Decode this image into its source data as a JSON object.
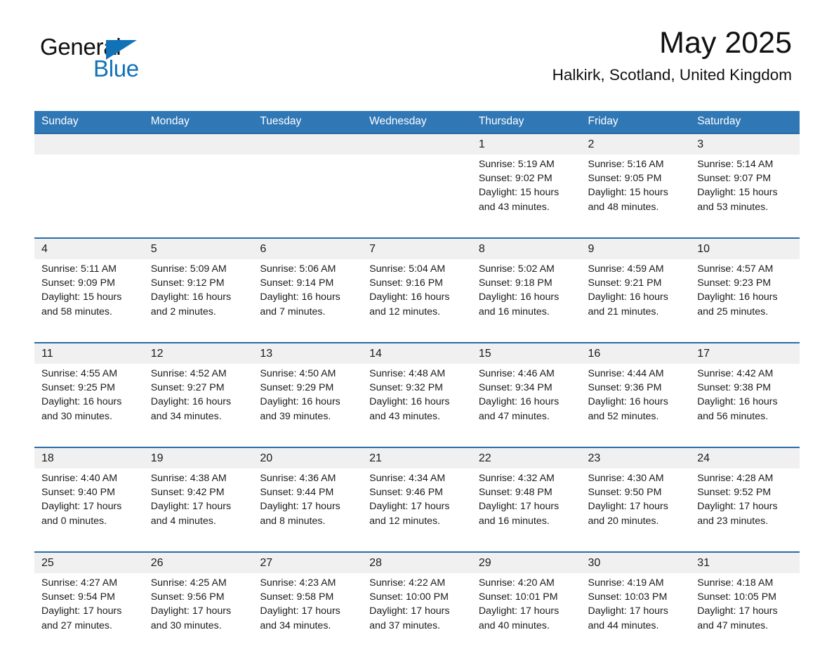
{
  "logo": {
    "word_one": "General",
    "word_two": "Blue",
    "triangle_icon": "triangle-icon",
    "brand_blue": "#1272b8"
  },
  "header": {
    "month_title": "May 2025",
    "location": "Halkirk, Scotland, United Kingdom",
    "header_blue": "#3077b6",
    "row_rule_blue": "#2b6ca8",
    "daynum_band": "#f0f0f0"
  },
  "weekday_headers": [
    "Sunday",
    "Monday",
    "Tuesday",
    "Wednesday",
    "Thursday",
    "Friday",
    "Saturday"
  ],
  "weeks": [
    {
      "days": [
        {
          "num": "",
          "sunrise": "",
          "sunset": "",
          "daylight_1": "",
          "daylight_2": "",
          "empty": true
        },
        {
          "num": "",
          "sunrise": "",
          "sunset": "",
          "daylight_1": "",
          "daylight_2": "",
          "empty": true
        },
        {
          "num": "",
          "sunrise": "",
          "sunset": "",
          "daylight_1": "",
          "daylight_2": "",
          "empty": true
        },
        {
          "num": "",
          "sunrise": "",
          "sunset": "",
          "daylight_1": "",
          "daylight_2": "",
          "empty": true
        },
        {
          "num": "1",
          "sunrise": "Sunrise: 5:19 AM",
          "sunset": "Sunset: 9:02 PM",
          "daylight_1": "Daylight: 15 hours",
          "daylight_2": "and 43 minutes.",
          "empty": false
        },
        {
          "num": "2",
          "sunrise": "Sunrise: 5:16 AM",
          "sunset": "Sunset: 9:05 PM",
          "daylight_1": "Daylight: 15 hours",
          "daylight_2": "and 48 minutes.",
          "empty": false
        },
        {
          "num": "3",
          "sunrise": "Sunrise: 5:14 AM",
          "sunset": "Sunset: 9:07 PM",
          "daylight_1": "Daylight: 15 hours",
          "daylight_2": "and 53 minutes.",
          "empty": false
        }
      ]
    },
    {
      "days": [
        {
          "num": "4",
          "sunrise": "Sunrise: 5:11 AM",
          "sunset": "Sunset: 9:09 PM",
          "daylight_1": "Daylight: 15 hours",
          "daylight_2": "and 58 minutes.",
          "empty": false
        },
        {
          "num": "5",
          "sunrise": "Sunrise: 5:09 AM",
          "sunset": "Sunset: 9:12 PM",
          "daylight_1": "Daylight: 16 hours",
          "daylight_2": "and 2 minutes.",
          "empty": false
        },
        {
          "num": "6",
          "sunrise": "Sunrise: 5:06 AM",
          "sunset": "Sunset: 9:14 PM",
          "daylight_1": "Daylight: 16 hours",
          "daylight_2": "and 7 minutes.",
          "empty": false
        },
        {
          "num": "7",
          "sunrise": "Sunrise: 5:04 AM",
          "sunset": "Sunset: 9:16 PM",
          "daylight_1": "Daylight: 16 hours",
          "daylight_2": "and 12 minutes.",
          "empty": false
        },
        {
          "num": "8",
          "sunrise": "Sunrise: 5:02 AM",
          "sunset": "Sunset: 9:18 PM",
          "daylight_1": "Daylight: 16 hours",
          "daylight_2": "and 16 minutes.",
          "empty": false
        },
        {
          "num": "9",
          "sunrise": "Sunrise: 4:59 AM",
          "sunset": "Sunset: 9:21 PM",
          "daylight_1": "Daylight: 16 hours",
          "daylight_2": "and 21 minutes.",
          "empty": false
        },
        {
          "num": "10",
          "sunrise": "Sunrise: 4:57 AM",
          "sunset": "Sunset: 9:23 PM",
          "daylight_1": "Daylight: 16 hours",
          "daylight_2": "and 25 minutes.",
          "empty": false
        }
      ]
    },
    {
      "days": [
        {
          "num": "11",
          "sunrise": "Sunrise: 4:55 AM",
          "sunset": "Sunset: 9:25 PM",
          "daylight_1": "Daylight: 16 hours",
          "daylight_2": "and 30 minutes.",
          "empty": false
        },
        {
          "num": "12",
          "sunrise": "Sunrise: 4:52 AM",
          "sunset": "Sunset: 9:27 PM",
          "daylight_1": "Daylight: 16 hours",
          "daylight_2": "and 34 minutes.",
          "empty": false
        },
        {
          "num": "13",
          "sunrise": "Sunrise: 4:50 AM",
          "sunset": "Sunset: 9:29 PM",
          "daylight_1": "Daylight: 16 hours",
          "daylight_2": "and 39 minutes.",
          "empty": false
        },
        {
          "num": "14",
          "sunrise": "Sunrise: 4:48 AM",
          "sunset": "Sunset: 9:32 PM",
          "daylight_1": "Daylight: 16 hours",
          "daylight_2": "and 43 minutes.",
          "empty": false
        },
        {
          "num": "15",
          "sunrise": "Sunrise: 4:46 AM",
          "sunset": "Sunset: 9:34 PM",
          "daylight_1": "Daylight: 16 hours",
          "daylight_2": "and 47 minutes.",
          "empty": false
        },
        {
          "num": "16",
          "sunrise": "Sunrise: 4:44 AM",
          "sunset": "Sunset: 9:36 PM",
          "daylight_1": "Daylight: 16 hours",
          "daylight_2": "and 52 minutes.",
          "empty": false
        },
        {
          "num": "17",
          "sunrise": "Sunrise: 4:42 AM",
          "sunset": "Sunset: 9:38 PM",
          "daylight_1": "Daylight: 16 hours",
          "daylight_2": "and 56 minutes.",
          "empty": false
        }
      ]
    },
    {
      "days": [
        {
          "num": "18",
          "sunrise": "Sunrise: 4:40 AM",
          "sunset": "Sunset: 9:40 PM",
          "daylight_1": "Daylight: 17 hours",
          "daylight_2": "and 0 minutes.",
          "empty": false
        },
        {
          "num": "19",
          "sunrise": "Sunrise: 4:38 AM",
          "sunset": "Sunset: 9:42 PM",
          "daylight_1": "Daylight: 17 hours",
          "daylight_2": "and 4 minutes.",
          "empty": false
        },
        {
          "num": "20",
          "sunrise": "Sunrise: 4:36 AM",
          "sunset": "Sunset: 9:44 PM",
          "daylight_1": "Daylight: 17 hours",
          "daylight_2": "and 8 minutes.",
          "empty": false
        },
        {
          "num": "21",
          "sunrise": "Sunrise: 4:34 AM",
          "sunset": "Sunset: 9:46 PM",
          "daylight_1": "Daylight: 17 hours",
          "daylight_2": "and 12 minutes.",
          "empty": false
        },
        {
          "num": "22",
          "sunrise": "Sunrise: 4:32 AM",
          "sunset": "Sunset: 9:48 PM",
          "daylight_1": "Daylight: 17 hours",
          "daylight_2": "and 16 minutes.",
          "empty": false
        },
        {
          "num": "23",
          "sunrise": "Sunrise: 4:30 AM",
          "sunset": "Sunset: 9:50 PM",
          "daylight_1": "Daylight: 17 hours",
          "daylight_2": "and 20 minutes.",
          "empty": false
        },
        {
          "num": "24",
          "sunrise": "Sunrise: 4:28 AM",
          "sunset": "Sunset: 9:52 PM",
          "daylight_1": "Daylight: 17 hours",
          "daylight_2": "and 23 minutes.",
          "empty": false
        }
      ]
    },
    {
      "days": [
        {
          "num": "25",
          "sunrise": "Sunrise: 4:27 AM",
          "sunset": "Sunset: 9:54 PM",
          "daylight_1": "Daylight: 17 hours",
          "daylight_2": "and 27 minutes.",
          "empty": false
        },
        {
          "num": "26",
          "sunrise": "Sunrise: 4:25 AM",
          "sunset": "Sunset: 9:56 PM",
          "daylight_1": "Daylight: 17 hours",
          "daylight_2": "and 30 minutes.",
          "empty": false
        },
        {
          "num": "27",
          "sunrise": "Sunrise: 4:23 AM",
          "sunset": "Sunset: 9:58 PM",
          "daylight_1": "Daylight: 17 hours",
          "daylight_2": "and 34 minutes.",
          "empty": false
        },
        {
          "num": "28",
          "sunrise": "Sunrise: 4:22 AM",
          "sunset": "Sunset: 10:00 PM",
          "daylight_1": "Daylight: 17 hours",
          "daylight_2": "and 37 minutes.",
          "empty": false
        },
        {
          "num": "29",
          "sunrise": "Sunrise: 4:20 AM",
          "sunset": "Sunset: 10:01 PM",
          "daylight_1": "Daylight: 17 hours",
          "daylight_2": "and 40 minutes.",
          "empty": false
        },
        {
          "num": "30",
          "sunrise": "Sunrise: 4:19 AM",
          "sunset": "Sunset: 10:03 PM",
          "daylight_1": "Daylight: 17 hours",
          "daylight_2": "and 44 minutes.",
          "empty": false
        },
        {
          "num": "31",
          "sunrise": "Sunrise: 4:18 AM",
          "sunset": "Sunset: 10:05 PM",
          "daylight_1": "Daylight: 17 hours",
          "daylight_2": "and 47 minutes.",
          "empty": false
        }
      ]
    }
  ]
}
